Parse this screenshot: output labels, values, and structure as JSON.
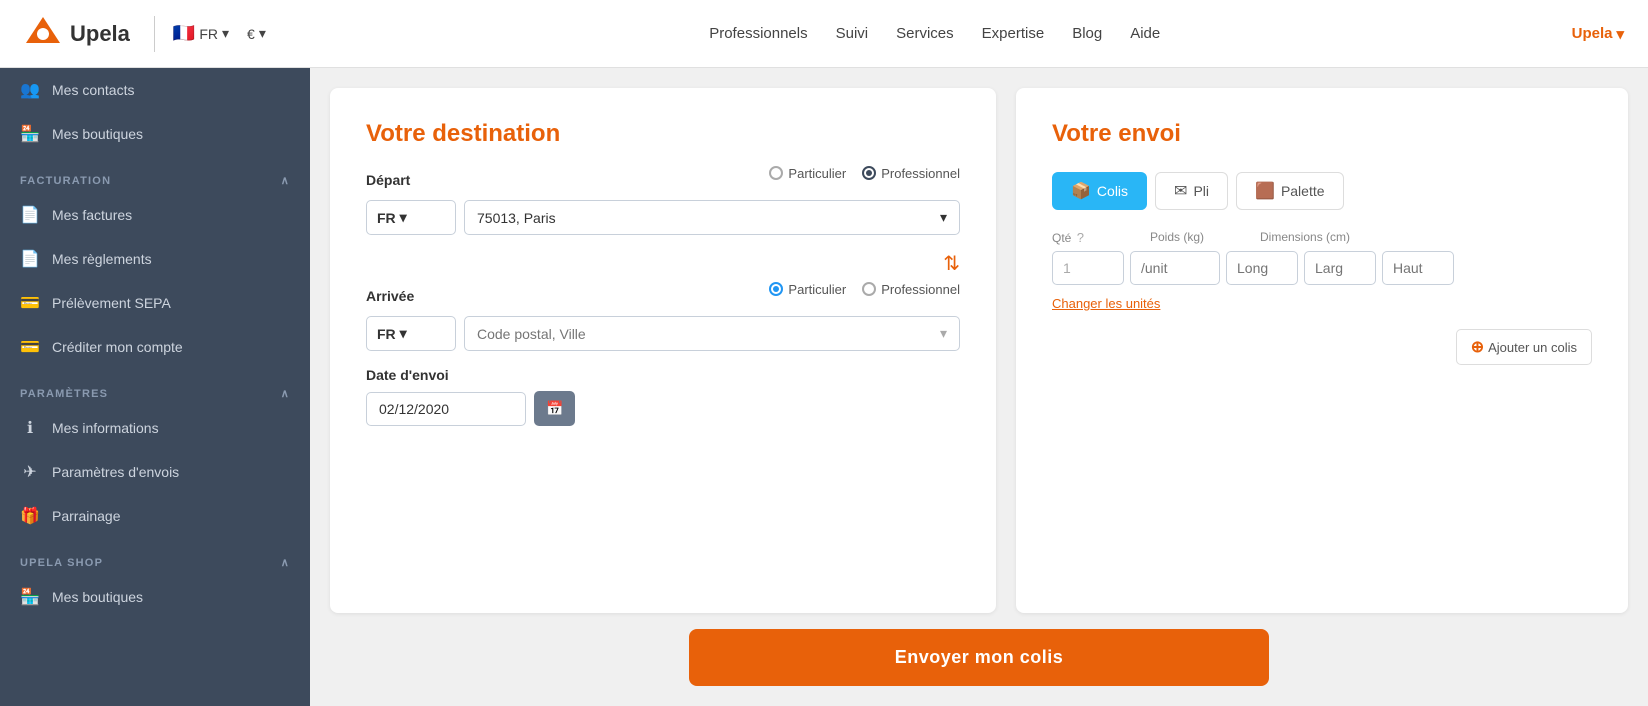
{
  "topnav": {
    "logo_text": "Upela",
    "lang": "FR",
    "currency": "€",
    "nav_links": [
      {
        "label": "Professionnels"
      },
      {
        "label": "Suivi"
      },
      {
        "label": "Services"
      },
      {
        "label": "Expertise"
      },
      {
        "label": "Blog"
      },
      {
        "label": "Aide"
      }
    ],
    "user_label": "Upela"
  },
  "sidebar": {
    "sections": [
      {
        "items": [
          {
            "icon": "👥",
            "label": "Mes contacts"
          },
          {
            "icon": "🏪",
            "label": "Mes boutiques"
          }
        ]
      },
      {
        "section_label": "FACTURATION",
        "items": [
          {
            "icon": "📄",
            "label": "Mes factures"
          },
          {
            "icon": "📄",
            "label": "Mes règlements"
          },
          {
            "icon": "💳",
            "label": "Prélèvement SEPA"
          },
          {
            "icon": "💳",
            "label": "Créditer mon compte"
          }
        ]
      },
      {
        "section_label": "PARAMÈTRES",
        "items": [
          {
            "icon": "ℹ",
            "label": "Mes informations"
          },
          {
            "icon": "✈",
            "label": "Paramètres d'envois"
          },
          {
            "icon": "🎁",
            "label": "Parrainage"
          }
        ]
      },
      {
        "section_label": "UPELA SHOP",
        "items": [
          {
            "icon": "🏪",
            "label": "Mes boutiques"
          }
        ]
      }
    ]
  },
  "destination": {
    "title": "Votre destination",
    "depart_label": "Départ",
    "depart_country": "FR",
    "depart_city": "75013, Paris",
    "depart_radio_particulier": "Particulier",
    "depart_radio_professionnel": "Professionnel",
    "depart_professionnel_selected": true,
    "arrivee_label": "Arrivée",
    "arrivee_country": "FR",
    "arrivee_city_placeholder": "Code postal, Ville",
    "arrivee_radio_particulier": "Particulier",
    "arrivee_radio_professionnel": "Professionnel",
    "arrivee_particulier_selected": true,
    "date_label": "Date d'envoi",
    "date_value": "02/12/2020"
  },
  "envoi": {
    "title": "Votre envoi",
    "tabs": [
      {
        "label": "Colis",
        "icon": "📦",
        "active": true
      },
      {
        "label": "Pli",
        "icon": "✉",
        "active": false
      },
      {
        "label": "Palette",
        "icon": "🟫",
        "active": false
      }
    ],
    "qty_header": "Qté",
    "weight_header": "Poids (kg)",
    "dimensions_header": "Dimensions (cm)",
    "qty_placeholder": "1",
    "weight_placeholder": "/unit",
    "long_placeholder": "Long",
    "larg_placeholder": "Larg",
    "haut_placeholder": "Haut",
    "change_units_label": "Changer les unités",
    "add_colis_label": "Ajouter un colis"
  },
  "bottom": {
    "send_label": "Envoyer mon colis"
  }
}
